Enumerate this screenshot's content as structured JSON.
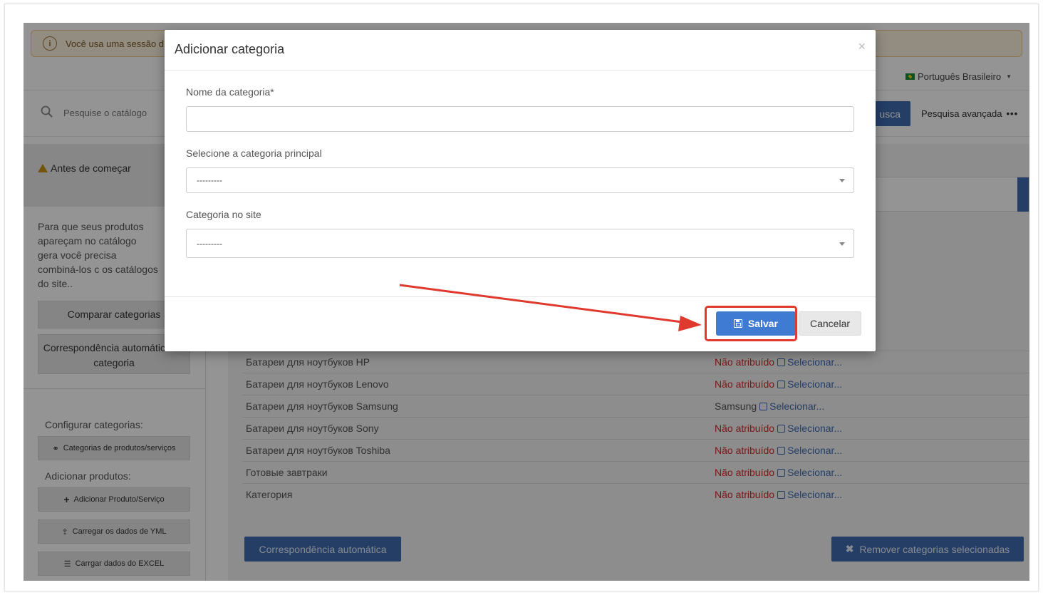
{
  "banner": {
    "text": "Você usa uma sessão d"
  },
  "topnav": {
    "menu_fragment": "a",
    "language": "Português Brasileiro"
  },
  "search": {
    "placeholder": "Pesquise o catálogo",
    "button_label": "usca",
    "advanced_label": "Pesquisa avançada"
  },
  "sidebar": {
    "notice_title": "Antes de começar",
    "notice_text": "Para que seus produtos apareçam no catálogo gera você precisa combiná-los c os catálogos do site..",
    "compare_button": "Comparar categorias",
    "auto_match_button": "Correspondência automática de categoria",
    "configure_label": "Configurar categorias:",
    "categories_button": "Categorias de produtos/serviços",
    "add_products_label": "Adicionar produtos:",
    "add_product_button": "Adicionar Produto/Serviço",
    "load_yml_button": "Carregar os dados de YML",
    "load_excel_button": "Carrgar dados do EXCEL"
  },
  "table": {
    "select_label": "Selecionar...",
    "rows": [
      {
        "name": "Батареи для ноутбуков HP",
        "status": "Não atribuído",
        "assigned": false
      },
      {
        "name": "Батареи для ноутбуков Lenovo",
        "status": "Não atribuído",
        "assigned": false
      },
      {
        "name": "Батареи для ноутбуков Samsung",
        "status": "Samsung",
        "assigned": true
      },
      {
        "name": "Батареи для ноутбуков Sony",
        "status": "Não atribuído",
        "assigned": false
      },
      {
        "name": "Батареи для ноутбуков Toshiba",
        "status": "Não atribuído",
        "assigned": false
      },
      {
        "name": "Готовые завтраки",
        "status": "Não atribuído",
        "assigned": false
      },
      {
        "name": "Категория",
        "status": "Não atribuído",
        "assigned": false
      }
    ]
  },
  "content_buttons": {
    "auto_match": "Correspondência automática",
    "remove_selected": "Remover categorias selecionadas"
  },
  "modal": {
    "title": "Adicionar categoria",
    "close": "×",
    "name_label": "Nome da categoria*",
    "name_value": "",
    "parent_label": "Selecione a categoria principal",
    "parent_value": "---------",
    "site_label": "Categoria no site",
    "site_value": "---------",
    "save_label": "Salvar",
    "cancel_label": "Cancelar"
  },
  "colors": {
    "primary": "#3f6cb0",
    "save": "#3f7ad3",
    "annotation": "#e03a2f",
    "unassigned": "#d42a2a"
  }
}
